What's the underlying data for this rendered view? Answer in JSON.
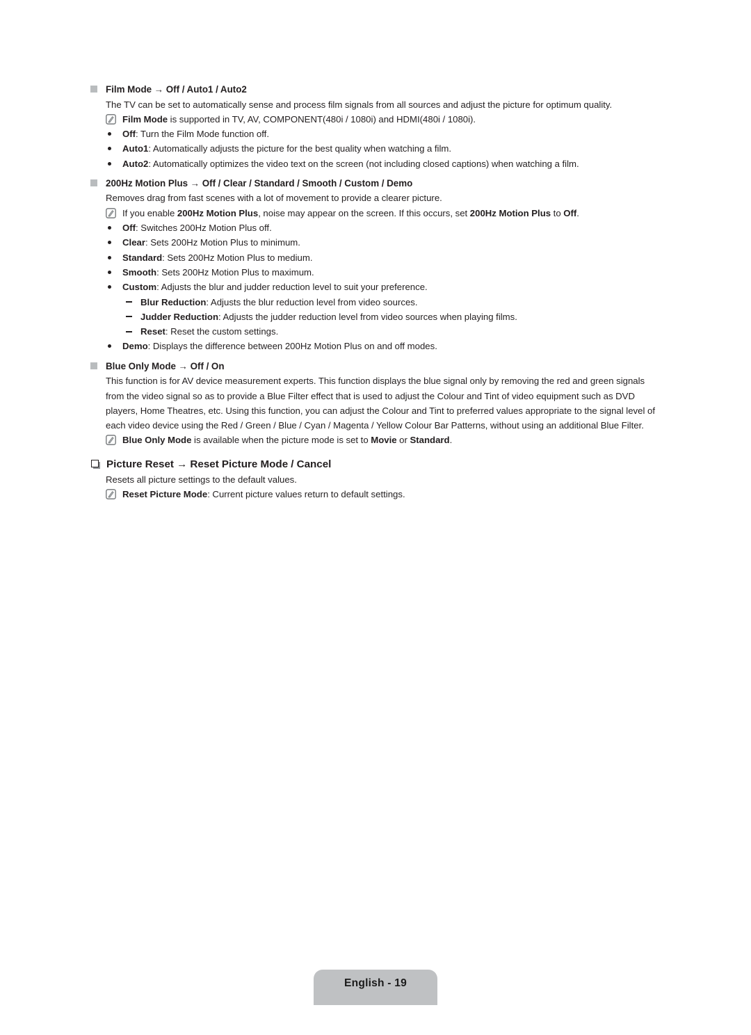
{
  "document": {
    "footer_label": "English - 19",
    "accent_marker_color": "#b9bcbe",
    "text_color": "#231f20",
    "footer_bg": "#bfc1c3"
  },
  "sections": {
    "film_mode": {
      "heading": "Film Mode → Off / Auto1 / Auto2",
      "intro": "The TV can be set to automatically sense and process film signals from all sources and adjust the picture for optimum quality.",
      "note": "Film Mode is supported in TV, AV, COMPONENT(480i / 1080i) and HDMI(480i / 1080i).",
      "note_bold": "Film Mode",
      "note_rest": " is supported in TV, AV, COMPONENT(480i / 1080i) and HDMI(480i / 1080i).",
      "options": [
        {
          "term": "Off",
          "desc": ": Turn the Film Mode function off."
        },
        {
          "term": "Auto1",
          "desc": ": Automatically adjusts the picture for the best quality when watching a film."
        },
        {
          "term": "Auto2",
          "desc": ": Automatically optimizes the video text on the screen (not including closed captions) when watching a film."
        }
      ]
    },
    "motion_plus": {
      "heading": "200Hz Motion Plus → Off / Clear / Standard / Smooth / Custom / Demo",
      "intro": "Removes drag from fast scenes with a lot of movement to provide a clearer picture.",
      "note_p1": "If you enable ",
      "note_b1": "200Hz Motion Plus",
      "note_p2": ", noise may appear on the screen. If this occurs, set ",
      "note_b2": "200Hz Motion Plus",
      "note_p3": " to ",
      "note_b3": "Off",
      "note_p4": ".",
      "options": [
        {
          "term": "Off",
          "desc": ": Switches 200Hz Motion Plus off."
        },
        {
          "term": "Clear",
          "desc": ": Sets 200Hz Motion Plus to minimum."
        },
        {
          "term": "Standard",
          "desc": ": Sets 200Hz Motion Plus to medium."
        },
        {
          "term": "Smooth",
          "desc": ": Sets 200Hz Motion Plus to maximum."
        },
        {
          "term": "Custom",
          "desc": ": Adjusts the blur and judder reduction level to suit your preference."
        }
      ],
      "sub_options": [
        {
          "term": "Blur Reduction",
          "desc": ": Adjusts the blur reduction level from video sources."
        },
        {
          "term": "Judder Reduction",
          "desc": ": Adjusts the judder reduction level from video sources when playing films."
        },
        {
          "term": "Reset",
          "desc": ": Reset the custom settings."
        }
      ],
      "last_option": {
        "term": "Demo",
        "desc": ": Displays the difference between 200Hz Motion Plus on and off modes."
      }
    },
    "blue_only": {
      "heading": "Blue Only Mode → Off / On",
      "body": "This function is for AV device measurement experts. This function displays the blue signal only by removing the red and green signals from the video signal so as to provide a Blue Filter effect that is used to adjust the Colour and Tint of video equipment such as DVD players, Home Theatres, etc. Using this function, you can adjust the Colour and Tint to preferred values appropriate to the signal level of each video device using the Red / Green / Blue / Cyan / Magenta / Yellow Colour Bar Patterns, without using an additional Blue Filter.",
      "note_b1": "Blue Only Mode",
      "note_p1": " is available when the picture mode is set to ",
      "note_b2": "Movie",
      "note_p2": " or ",
      "note_b3": "Standard",
      "note_p3": "."
    },
    "picture_reset": {
      "heading": "Picture Reset → Reset Picture Mode / Cancel",
      "intro": "Resets all picture settings to the default values.",
      "note_b1": "Reset Picture Mode",
      "note_p1": ": Current picture values return to default settings."
    }
  }
}
